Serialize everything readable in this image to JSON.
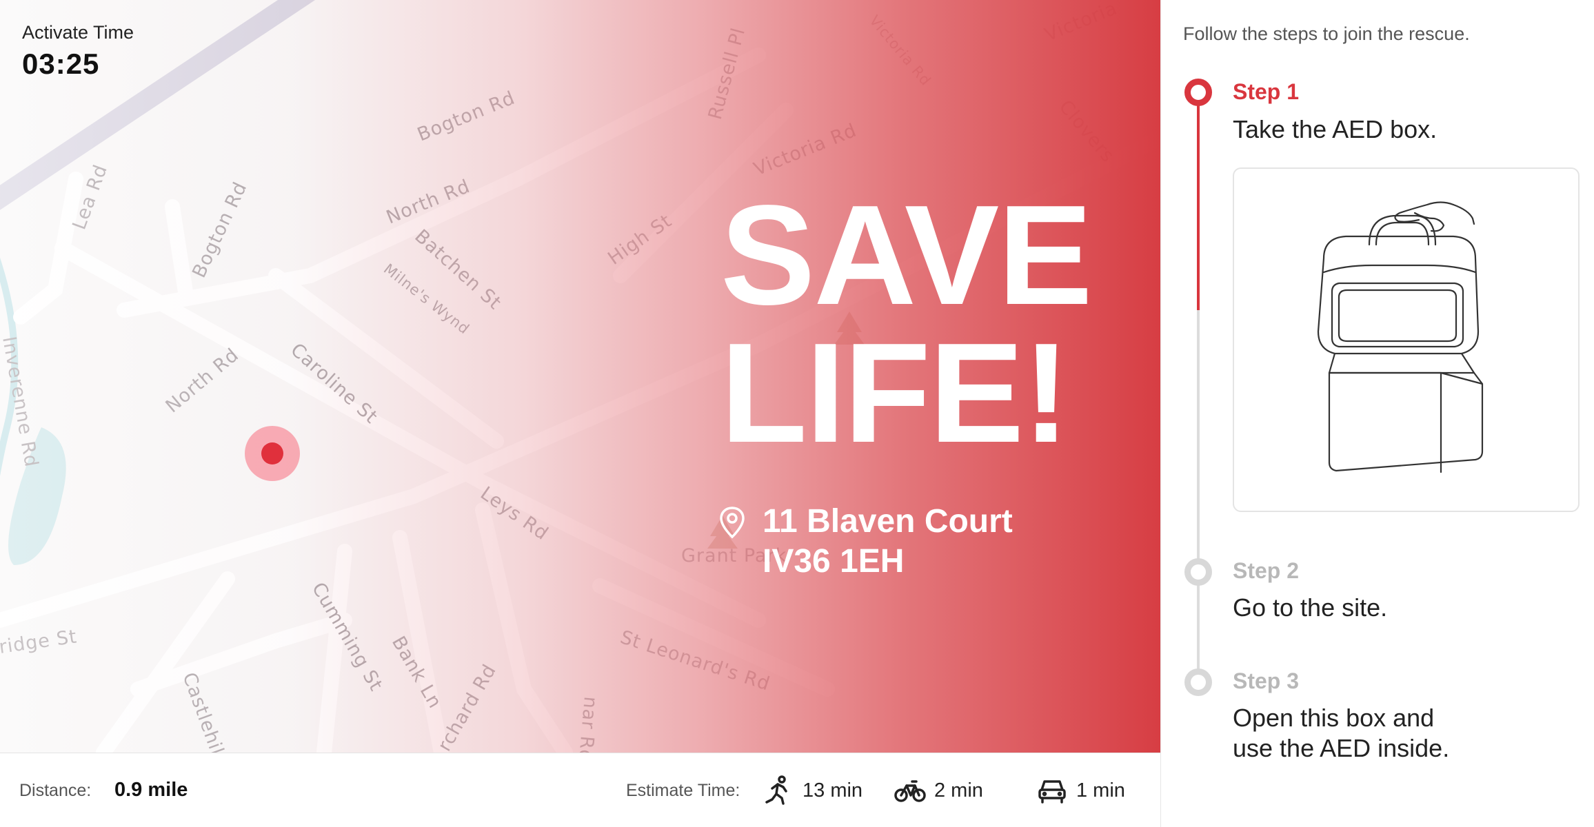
{
  "activate": {
    "label": "Activate Time",
    "time": "03:25"
  },
  "map": {
    "streets": {
      "bogton_rd_top": "Bogton Rd",
      "russell_pl": "Russell Pl",
      "victoria_rd_small": "Victoria Rd",
      "victoria_rd": "Victoria Rd",
      "victoria_top": "Victoria",
      "clovers": "Clovers",
      "lea_rd": "Lea Rd",
      "bogton_rd_left": "Bogton Rd",
      "north_rd_top": "North Rd",
      "batchen_st": "Batchen St",
      "milnes_wynd": "Milne's Wynd",
      "high_st": "High St",
      "north_rd_left": "North Rd",
      "caroline_st": "Caroline St",
      "inverenne_rd": "Inverenne Rd",
      "leys_rd": "Leys Rd",
      "grant_park": "Grant Park",
      "bridge_st": "ridge St",
      "st_leonards_rd": "St Leonard's Rd",
      "cumming_st": "Cumming St",
      "bank_ln": "Bank Ln",
      "orchard_rd": "rchard Rd",
      "castlehill": "Castlehil",
      "other_rd": "nar Rd",
      "park_fragment": "n"
    }
  },
  "headline": {
    "line1": "SAVE",
    "line2": "LIFE!"
  },
  "address": {
    "line1": "11 Blaven Court",
    "line2": "IV36 1EH"
  },
  "info_bar": {
    "distance_label": "Distance:",
    "distance_value": "0.9 mile",
    "estimate_label": "Estimate Time:",
    "walk_time": "13 min",
    "bike_time": "2 min",
    "car_time": "1 min"
  },
  "steps": {
    "intro": "Follow the steps to join the rescue.",
    "items": [
      {
        "title": "Step 1",
        "desc": "Take the AED box.",
        "active": true
      },
      {
        "title": "Step 2",
        "desc": "Go to the site.",
        "active": false
      },
      {
        "title": "Step 3",
        "desc_line1": "Open this box and",
        "desc_line2": "use the AED inside.",
        "active": false
      }
    ]
  },
  "icons": {
    "location_pin": "location-pin-icon",
    "walk": "walking-person-icon",
    "bike": "bicycle-icon",
    "car": "car-icon",
    "tree": "tree-icon"
  },
  "colors": {
    "accent": "#d9363e",
    "inactive": "#d8d8d8",
    "location_dot": "#e0303c"
  }
}
